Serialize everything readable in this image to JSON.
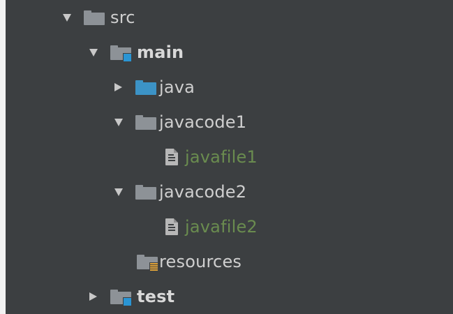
{
  "tree": {
    "src": {
      "label": "src",
      "expanded": true
    },
    "main": {
      "label": "main",
      "expanded": true
    },
    "java": {
      "label": "java",
      "expanded": false
    },
    "javacode1": {
      "label": "javacode1",
      "expanded": true
    },
    "javafile1": {
      "label": "javafile1"
    },
    "javacode2": {
      "label": "javacode2",
      "expanded": true
    },
    "javafile2": {
      "label": "javafile2"
    },
    "resources": {
      "label": "resources"
    },
    "test": {
      "label": "test",
      "expanded": false
    }
  },
  "colors": {
    "panel_bg": "#3c3f41",
    "text": "#cfcfcf",
    "modified_file_text": "#6a8c4f",
    "folder_gray": "#8d9297",
    "folder_blue": "#3c93c6",
    "source_badge": "#2a95d4",
    "resource_badge": "#e0a33a"
  },
  "icons": {
    "src": "folder-icon",
    "main": "source-root-folder-icon",
    "java": "source-package-folder-icon",
    "javacode1": "folder-icon",
    "javafile1": "text-file-icon",
    "javacode2": "folder-icon",
    "javafile2": "text-file-icon",
    "resources": "resources-root-folder-icon",
    "test": "test-root-folder-icon"
  }
}
